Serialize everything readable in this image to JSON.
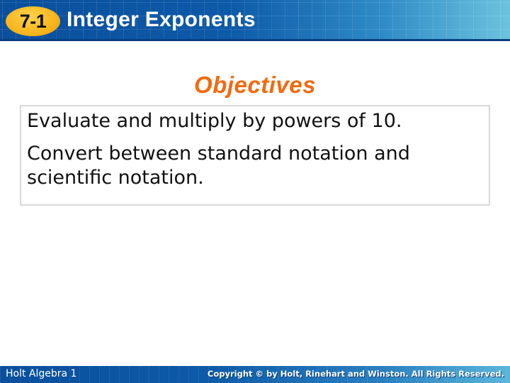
{
  "header": {
    "badge": "7-1",
    "title": "Integer Exponents",
    "colors": {
      "bar_start": "#0a4f9c",
      "bar_end": "#6cc3de",
      "badge": "#f7b51c"
    }
  },
  "main": {
    "heading": "Objectives",
    "heading_color": "#f26a10",
    "objectives": [
      "Evaluate and multiply by powers of 10.",
      "Convert between standard notation and",
      "scientific notation."
    ]
  },
  "footer": {
    "left": "Holt Algebra 1",
    "right": "Copyright © by Holt, Rinehart and Winston. All Rights Reserved."
  }
}
